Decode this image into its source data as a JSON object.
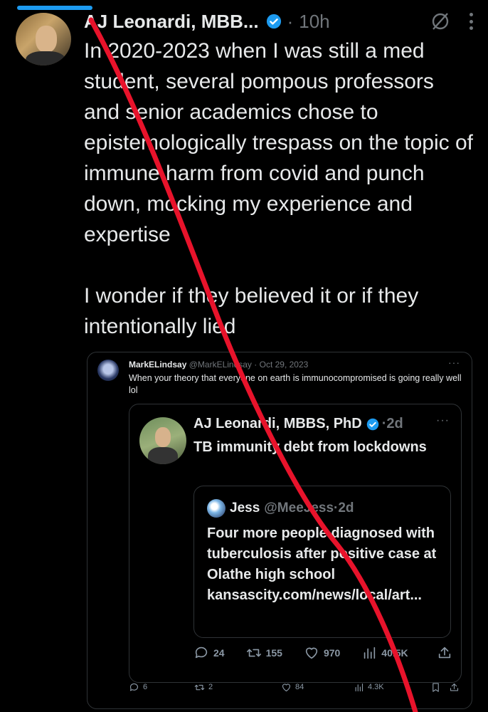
{
  "main_tweet": {
    "author": "AJ Leonardi, MBB...",
    "separator": "·",
    "time": "10h",
    "text": "In 2020-2023 when I was still a med student, several pompous professors and senior academics chose to epistemologically trespass on the topic of immune harm from covid and punch down, mocking my experience and expertise\n\nI wonder if they believed it or if they intentionally lied"
  },
  "quote1": {
    "name": "MarkELindsay",
    "handle": "@MarkELindsay",
    "date": "· Oct 29, 2023",
    "more": "···",
    "text": "When your theory that everyone on earth is immunocompromised is going really well lol",
    "actions": {
      "replies": "6",
      "retweets": "2",
      "likes": "84",
      "views": "4.3K"
    }
  },
  "quote2": {
    "name": "AJ Leonardi, MBBS, PhD",
    "time": "·2d",
    "more": "···",
    "text": "TB immunity debt from lockdowns",
    "actions": {
      "replies": "24",
      "retweets": "155",
      "likes": "970",
      "views": "40.5K"
    }
  },
  "quote3": {
    "name": "Jess",
    "handle": "@MeeJess·2d",
    "text": "Four more people diagnosed with tuberculosis after positive case at Olathe high school kansascity.com/news/local/art..."
  },
  "colors": {
    "background": "#000000",
    "text": "#e7e9ea",
    "muted": "#71767b",
    "verified": "#1d9bf0",
    "annotation": "#e8132b"
  },
  "icons": [
    "verified-badge-icon",
    "grok-icon",
    "more-icon",
    "reply-icon",
    "retweet-icon",
    "like-icon",
    "views-icon",
    "bookmark-icon",
    "share-icon"
  ]
}
